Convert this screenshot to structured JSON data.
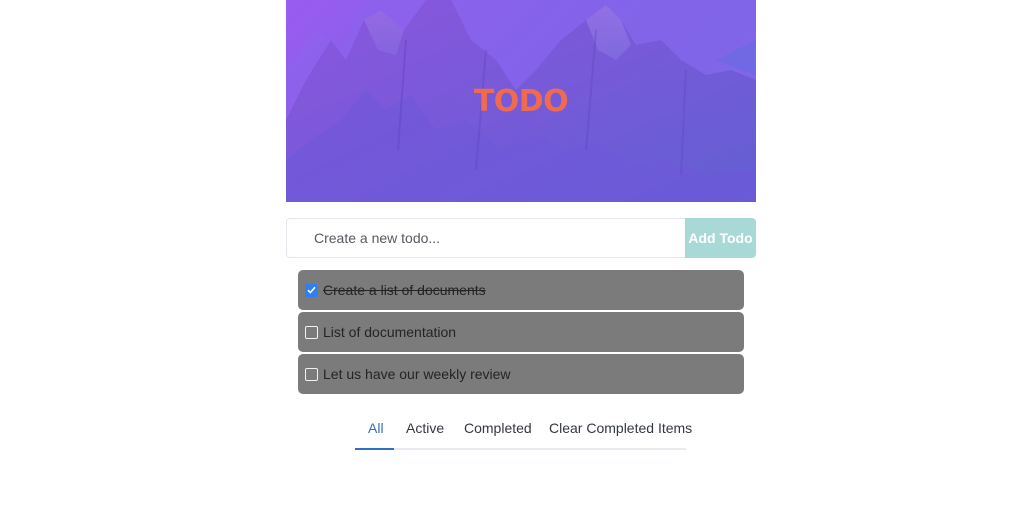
{
  "app": {
    "title": "TODO",
    "title_color": "#ee6a50",
    "accent": "#a9d9d6"
  },
  "input": {
    "placeholder": "Create a new todo...",
    "value": "",
    "add_label": "Add Todo"
  },
  "todos": [
    {
      "text": "Create a list of documents",
      "completed": true
    },
    {
      "text": "List of documentation",
      "completed": false
    },
    {
      "text": "Let us have our weekly review",
      "completed": false
    }
  ],
  "filters": {
    "all": "All",
    "active": "Active",
    "completed": "Completed",
    "clear": "Clear Completed Items",
    "selected": "All"
  }
}
